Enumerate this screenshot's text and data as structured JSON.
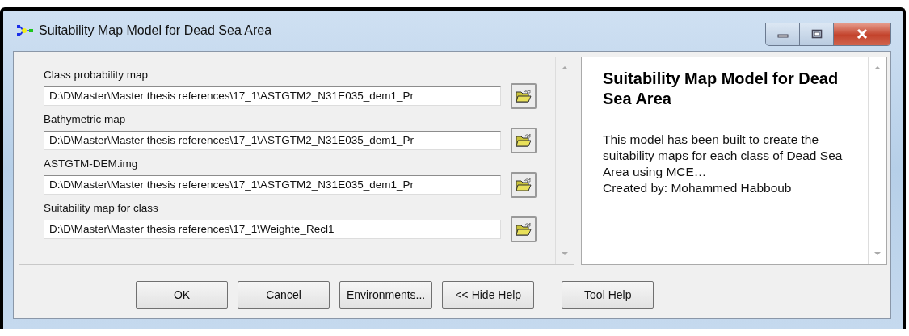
{
  "window": {
    "title": "Suitability Map Model for Dead Sea Area"
  },
  "fields": [
    {
      "label": "Class probability map",
      "value": "D:\\D\\Master\\Master thesis references\\17_1\\ASTGTM2_N31E035_dem1_Pr"
    },
    {
      "label": "Bathymetric map",
      "value": "D:\\D\\Master\\Master thesis references\\17_1\\ASTGTM2_N31E035_dem1_Pr"
    },
    {
      "label": "ASTGTM-DEM.img",
      "value": "D:\\D\\Master\\Master thesis references\\17_1\\ASTGTM2_N31E035_dem1_Pr"
    },
    {
      "label": "Suitability map for class",
      "value": "D:\\D\\Master\\Master thesis references\\17_1\\Weighte_Recl1"
    }
  ],
  "help": {
    "heading": "Suitability Map Model for Dead Sea Area",
    "body": "This model has been built to create the suitability maps for each class of Dead Sea Area using MCE…",
    "credit": "Created by: Mohammed Habboub"
  },
  "buttons": [
    "OK",
    "Cancel",
    "Environments...",
    "<< Hide Help",
    "Tool Help"
  ]
}
